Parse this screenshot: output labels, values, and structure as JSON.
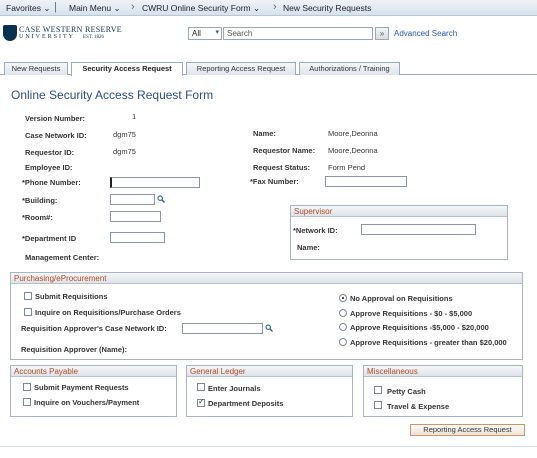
{
  "topnav": {
    "favorites": "Favorites",
    "main_menu": "Main Menu",
    "crumb1": "CWRU Online Security Form",
    "crumb2": "New Security Requests"
  },
  "logo": {
    "line1": "CASE WESTERN RESERVE",
    "line2": "UNIVERSITY",
    "line3": "EST. 1826"
  },
  "search": {
    "scope": "All",
    "placeholder": "Search",
    "go": "»",
    "advanced": "Advanced Search"
  },
  "tabs": [
    {
      "label": "New Requests"
    },
    {
      "label": "Security Access Request"
    },
    {
      "label": "Reporting Access Request"
    },
    {
      "label": "Authorizations / Training"
    }
  ],
  "form": {
    "title": "Online Security Access Request Form",
    "version_label": "Version Number:",
    "version_value": "1",
    "case_network_id_label": "Case Network ID:",
    "case_network_id_value": "dgm75",
    "name_label": "Name:",
    "name_value": "Moore,Deonna",
    "requestor_id_label": "Requestor ID:",
    "requestor_id_value": "dgm75",
    "requestor_name_label": "Requestor Name:",
    "requestor_name_value": "Moore,Deonna",
    "employee_id_label": "Employee ID:",
    "request_status_label": "Request Status:",
    "request_status_value": "Form Pend",
    "phone_label": "*Phone Number:",
    "fax_label": "*Fax Number:",
    "building_label": "*Building:",
    "room_label": "*Room#:",
    "department_label": "*Department ID",
    "management_center_label": "Management Center:"
  },
  "supervisor": {
    "header": "Supervisor",
    "network_id_label": "*Network ID:",
    "name_label": "Name:"
  },
  "purchasing": {
    "header": "Purchasing/eProcurement",
    "submit_req": "Submit Requisitions",
    "inquire_req": "Inquire on Requisitions/Purchase Orders",
    "approver_id_label": "Requisition Approver's Case Network ID:",
    "approver_name_label": "Requisition Approver (Name):",
    "radio_options": [
      {
        "label": "No Approval on Requisitions",
        "selected": true
      },
      {
        "label": "Approve Requisitions - $0 - $5,000",
        "selected": false
      },
      {
        "label": "Approve Requisitions -$5,000 - $20,000",
        "selected": false
      },
      {
        "label": "Approve Requisitions - greater than $20,000",
        "selected": false
      }
    ]
  },
  "accounts_payable": {
    "header": "Accounts Payable",
    "items": [
      {
        "label": "Submit Payment Requests",
        "checked": false
      },
      {
        "label": "Inquire on Vouchers/Payment",
        "checked": false
      }
    ]
  },
  "general_ledger": {
    "header": "General Ledger",
    "items": [
      {
        "label": "Enter Journals",
        "checked": false
      },
      {
        "label": "Department Deposits",
        "checked": true
      }
    ]
  },
  "miscellaneous": {
    "header": "Miscellaneous",
    "items": [
      {
        "label": "Petty Cash",
        "checked": false
      },
      {
        "label": "Travel & Expense",
        "checked": false
      }
    ]
  },
  "footer": {
    "reporting_button": "Reporting Access Request"
  }
}
